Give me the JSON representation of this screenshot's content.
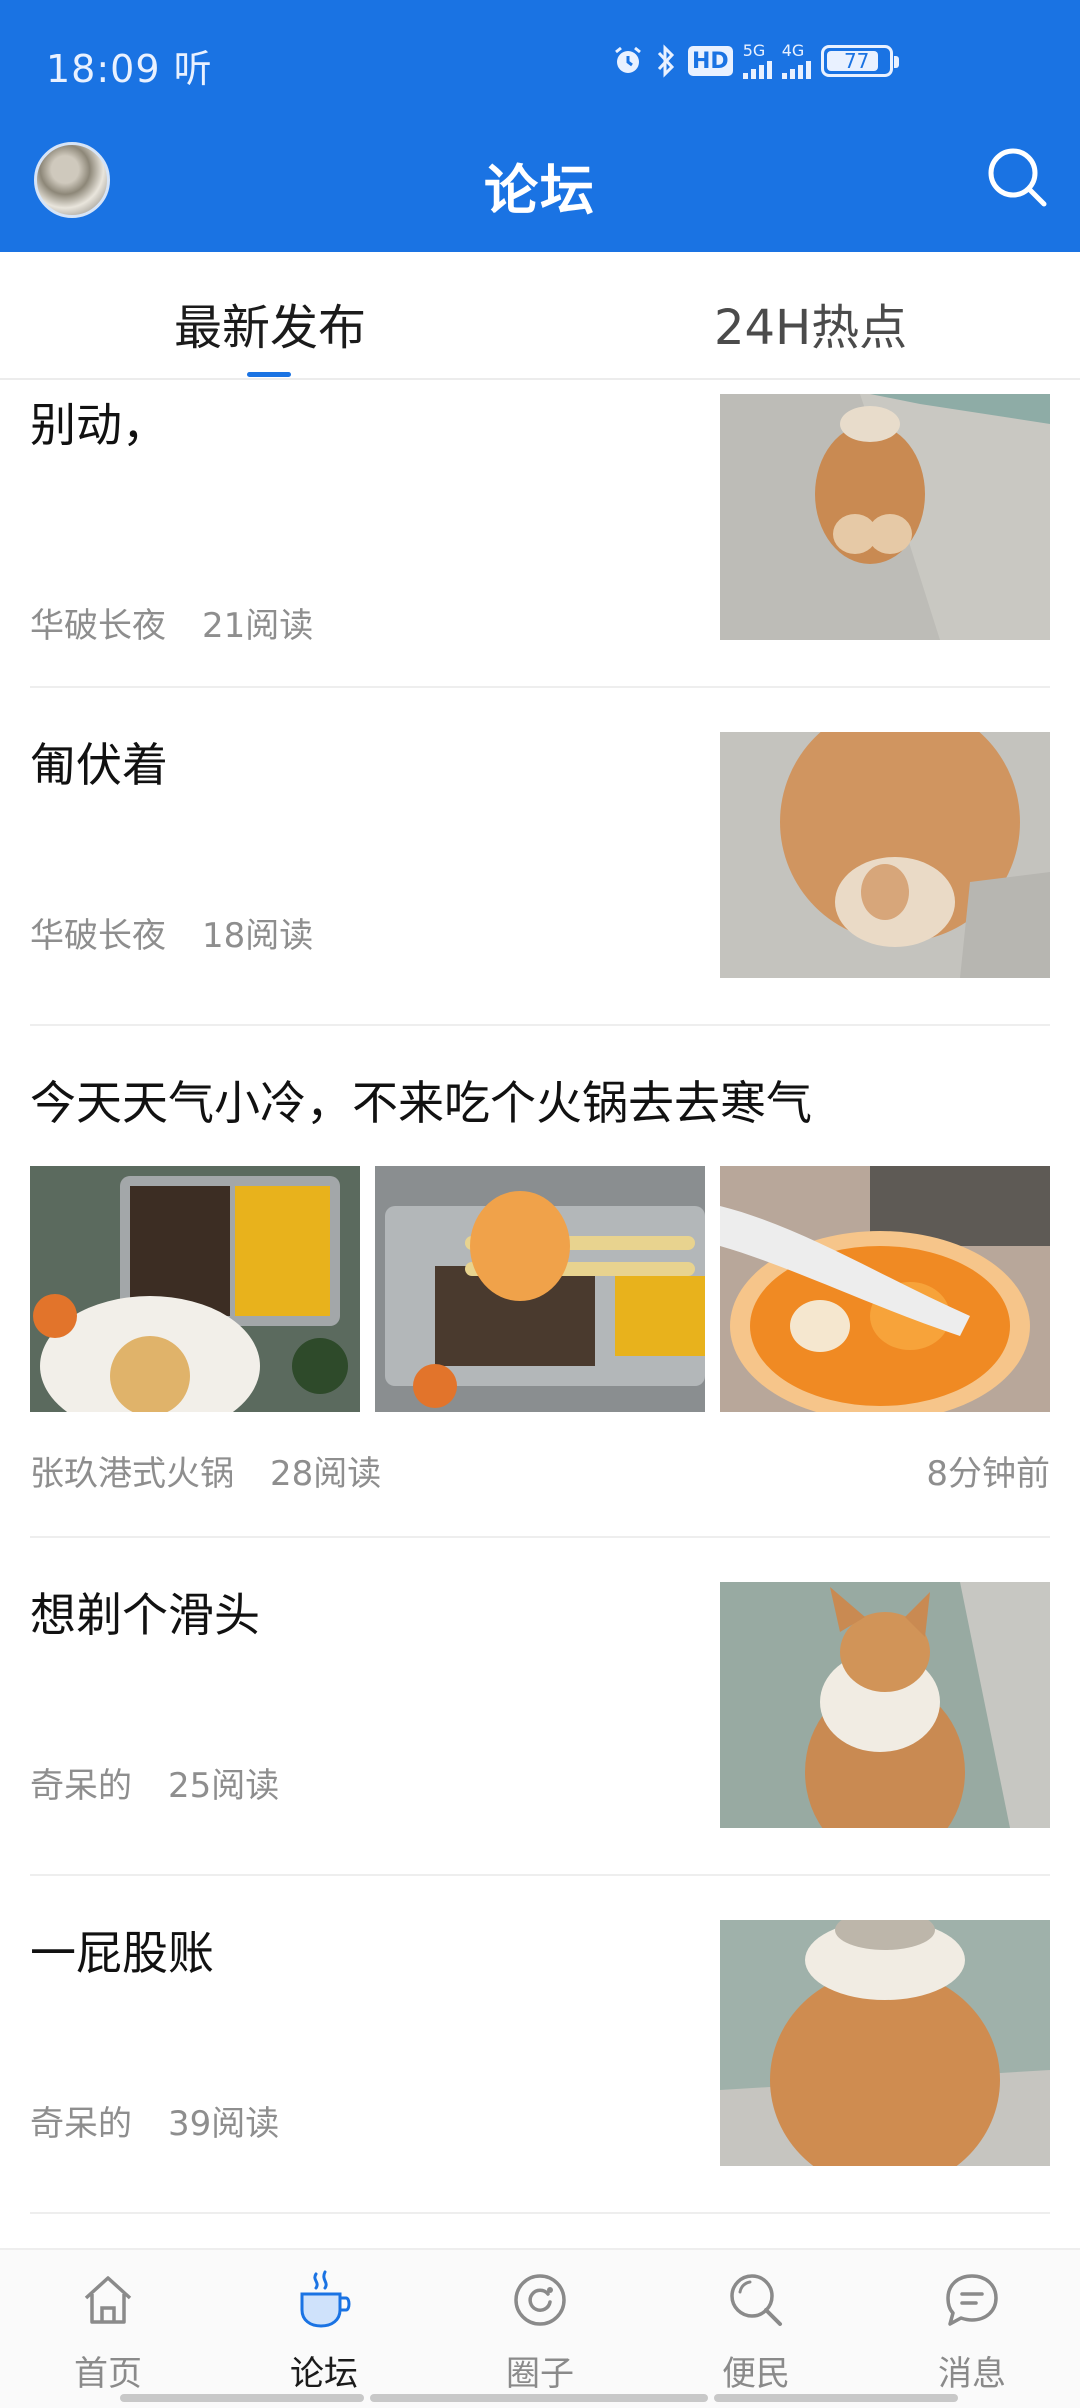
{
  "status_bar": {
    "time": "18:09",
    "extra": "听",
    "hd_label": "HD",
    "net1": "5G",
    "net2": "4G",
    "battery": "77"
  },
  "header": {
    "title": "论坛"
  },
  "tabs": [
    {
      "label": "最新发布",
      "active": true
    },
    {
      "label": "24H热点",
      "active": false
    }
  ],
  "posts": [
    {
      "title": "别动，",
      "author": "华破长夜",
      "reads": "21阅读",
      "time": ""
    },
    {
      "title": "匍伏着",
      "author": "华破长夜",
      "reads": "18阅读",
      "time": ""
    },
    {
      "title": "今天天气小冷，不来吃个火锅去去寒气",
      "author": "张玖港式火锅",
      "reads": "28阅读",
      "time": "8分钟前"
    },
    {
      "title": "想剃个滑头",
      "author": "奇呆的",
      "reads": "25阅读",
      "time": ""
    },
    {
      "title": "一屁股账",
      "author": "奇呆的",
      "reads": "39阅读",
      "time": ""
    }
  ],
  "bottom_nav": [
    {
      "label": "首页",
      "icon": "home-icon",
      "active": false
    },
    {
      "label": "论坛",
      "icon": "coffee-cup-icon",
      "active": true
    },
    {
      "label": "圈子",
      "icon": "circle-icon",
      "active": false
    },
    {
      "label": "便民",
      "icon": "search-icon",
      "active": false
    },
    {
      "label": "消息",
      "icon": "message-icon",
      "active": false
    }
  ],
  "colors": {
    "brand": "#1a73e3",
    "meta_text": "#8e8e8e"
  }
}
